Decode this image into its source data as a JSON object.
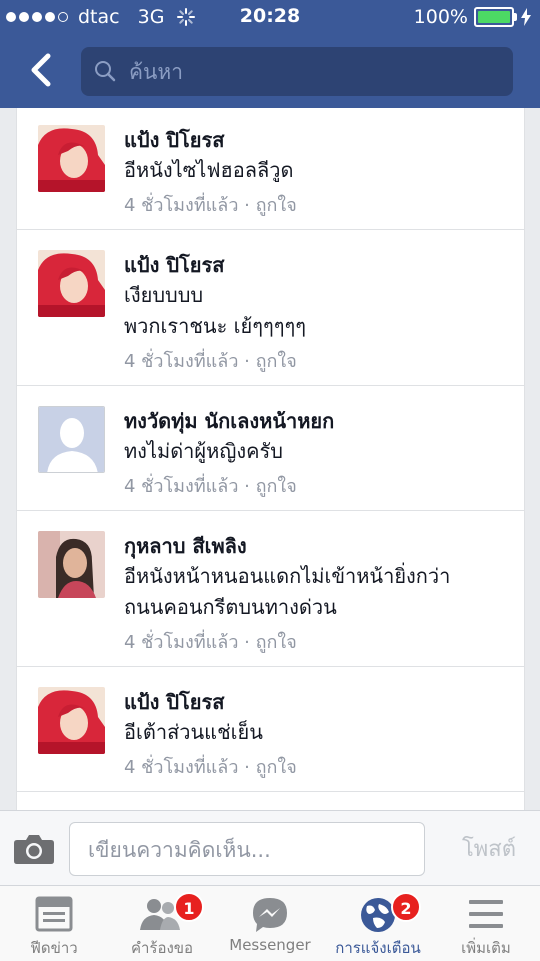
{
  "status_bar": {
    "carrier": "dtac",
    "network": "3G",
    "time": "20:28",
    "battery": "100%",
    "signal_bars_filled": 4
  },
  "header": {
    "search_placeholder": "ค้นหา"
  },
  "comments": [
    {
      "name": "แป้ง ปิโยรส",
      "lines": [
        "อีหนังไซไฟฮอลลีวูด"
      ],
      "time": "4 ชั่วโมงที่แล้ว",
      "like": "ถูกใจ",
      "avatar": "red-hair-woman"
    },
    {
      "name": "แป้ง ปิโยรส",
      "lines": [
        "เงียบบบบ",
        "พวกเราชนะ เย้ๆๆๆๆๆ"
      ],
      "time": "4 ชั่วโมงที่แล้ว",
      "like": "ถูกใจ",
      "avatar": "red-hair-woman"
    },
    {
      "name": "ทงวัดทุ่ม นักเลงหน้าหยก",
      "lines": [
        "ทงไม่ด่าผู้หญิงครับ"
      ],
      "time": "4 ชั่วโมงที่แล้ว",
      "like": "ถูกใจ",
      "avatar": "default-silhouette"
    },
    {
      "name": "กุหลาบ สีเพลิง",
      "lines": [
        "อีหนังหน้าหนอนแดกไม่เข้าหน้ายิ่งกว่า",
        "ถนนคอนกรีตบนทางด่วน"
      ],
      "time": "4 ชั่วโมงที่แล้ว",
      "like": "ถูกใจ",
      "avatar": "woman-portrait"
    },
    {
      "name": "แป้ง ปิโยรส",
      "lines": [
        "อีเต้าส่วนแช่เย็น"
      ],
      "time": "4 ชั่วโมงที่แล้ว",
      "like": "ถูกใจ",
      "avatar": "red-hair-woman"
    }
  ],
  "composer": {
    "placeholder": "เขียนความคิดเห็น...",
    "post_label": "โพสต์"
  },
  "tabbar": [
    {
      "label": "ฟีดข่าว",
      "icon": "news-feed-icon",
      "badge": ""
    },
    {
      "label": "คำร้องขอ",
      "icon": "friend-requests-icon",
      "badge": "1"
    },
    {
      "label": "Messenger",
      "icon": "messenger-icon",
      "badge": ""
    },
    {
      "label": "การแจ้งเตือน",
      "icon": "globe-notifications-icon",
      "badge": "2",
      "active": true
    },
    {
      "label": "เพิ่มเติม",
      "icon": "menu-icon",
      "badge": ""
    }
  ],
  "colors": {
    "header": "#3b5998",
    "badge": "#e7211f",
    "active_tab": "#3b5998",
    "battery": "#4cd964"
  }
}
